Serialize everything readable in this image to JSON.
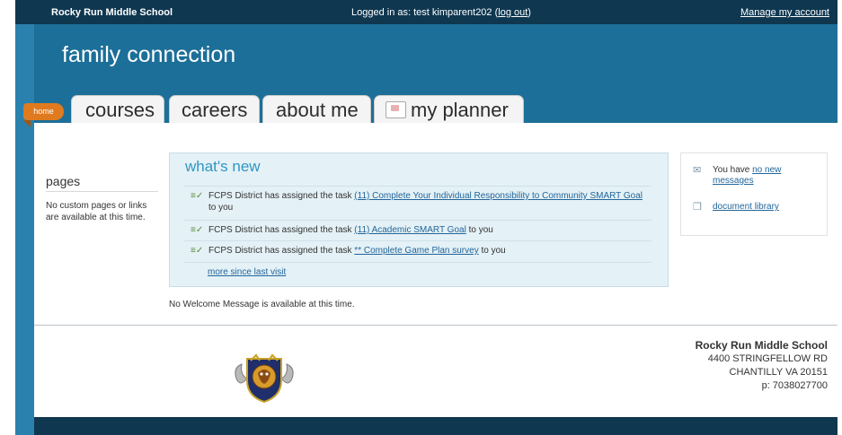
{
  "topbar": {
    "school": "Rocky Run Middle School",
    "logged_prefix": "Logged in as: test kimparent202 (",
    "logout": "log out",
    "logged_suffix": ")",
    "manage": "Manage my account"
  },
  "brand": "family connection",
  "tabs": {
    "home": "home",
    "courses": "courses",
    "careers": "careers",
    "about_me": "about me",
    "planner": "my planner"
  },
  "pages": {
    "title": "pages",
    "text": "No custom pages or links are available at this time."
  },
  "whats_new": {
    "title": "what's new",
    "items": [
      {
        "prefix": "FCPS District has assigned the task ",
        "link": "(11) Complete Your Individual Responsibility to Community SMART Goal",
        "suffix": " to you"
      },
      {
        "prefix": "FCPS District has assigned the task ",
        "link": "(11) Academic SMART Goal",
        "suffix": " to you"
      },
      {
        "prefix": "FCPS District has assigned the task ",
        "link": "** Complete Game Plan survey",
        "suffix": " to you"
      }
    ],
    "more": "more since last visit"
  },
  "welcome": "No Welcome Message is available at this time.",
  "sidebar": {
    "messages_prefix": "You have ",
    "messages_link": "no new messages",
    "library": "document library"
  },
  "footer": {
    "name": "Rocky Run Middle School",
    "street": "4400 STRINGFELLOW RD",
    "city": "CHANTILLY VA 20151",
    "phone": "p: 7038027700"
  },
  "colors": {
    "header": "#1c6f98",
    "topbar": "#0f3750",
    "home_tab": "#e07a1f",
    "link": "#23669a"
  }
}
